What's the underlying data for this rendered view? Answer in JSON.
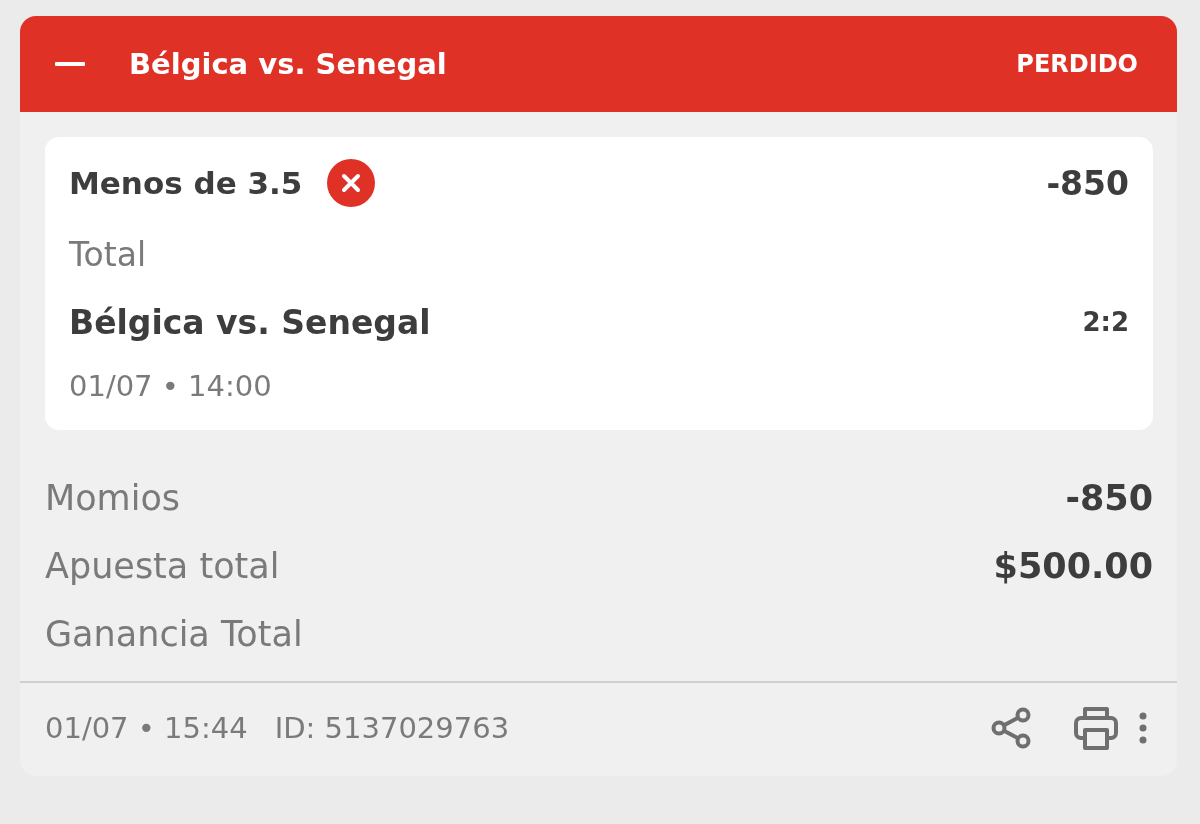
{
  "bet_card": {
    "header": {
      "expanded": true,
      "title": "Bélgica vs. Senegal",
      "status": "PERDIDO",
      "kind": "lost"
    },
    "selections": [
      {
        "pick": "Menos de 3.5",
        "kind": "lost",
        "odds": "-850",
        "market": "Total",
        "event": "Bélgica vs. Senegal",
        "score": "2:2",
        "event_time": "01/07 • 14:00"
      }
    ],
    "summary": [
      {
        "label": "Momios",
        "value": "-850"
      },
      {
        "label": "Apuesta total",
        "value": "$500.00"
      },
      {
        "label": "Ganancia Total"
      }
    ],
    "footer": {
      "placed_at": "01/07 • 15:44",
      "bet_id": "ID: 5137029763"
    }
  }
}
